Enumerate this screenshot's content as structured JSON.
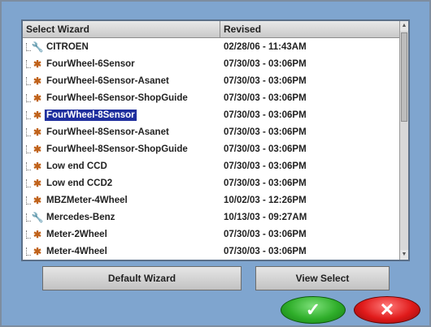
{
  "table": {
    "headers": {
      "name": "Select Wizard",
      "revised": "Revised"
    },
    "rows": [
      {
        "name": "CITROEN",
        "revised": "02/28/06 - 11:43AM",
        "icon": "wrench-icon"
      },
      {
        "name": "FourWheel-6Sensor",
        "revised": "07/30/03 - 03:06PM",
        "icon": "vehicle-icon"
      },
      {
        "name": "FourWheel-6Sensor-Asanet",
        "revised": "07/30/03 - 03:06PM",
        "icon": "vehicle-icon"
      },
      {
        "name": "FourWheel-6Sensor-ShopGuide",
        "revised": "07/30/03 - 03:06PM",
        "icon": "vehicle-icon"
      },
      {
        "name": "FourWheel-8Sensor",
        "revised": "07/30/03 - 03:06PM",
        "icon": "vehicle-icon",
        "selected": true
      },
      {
        "name": "FourWheel-8Sensor-Asanet",
        "revised": "07/30/03 - 03:06PM",
        "icon": "vehicle-icon"
      },
      {
        "name": "FourWheel-8Sensor-ShopGuide",
        "revised": "07/30/03 - 03:06PM",
        "icon": "vehicle-icon"
      },
      {
        "name": "Low end CCD",
        "revised": "07/30/03 - 03:06PM",
        "icon": "vehicle-icon"
      },
      {
        "name": "Low end CCD2",
        "revised": "07/30/03 - 03:06PM",
        "icon": "vehicle-icon"
      },
      {
        "name": "MBZMeter-4Wheel",
        "revised": "10/02/03 - 12:26PM",
        "icon": "vehicle-icon"
      },
      {
        "name": "Mercedes-Benz",
        "revised": "10/13/03 - 09:27AM",
        "icon": "wrench-icon"
      },
      {
        "name": "Meter-2Wheel",
        "revised": "07/30/03 - 03:06PM",
        "icon": "vehicle-icon"
      },
      {
        "name": "Meter-4Wheel",
        "revised": "07/30/03 - 03:06PM",
        "icon": "vehicle-icon"
      }
    ]
  },
  "buttons": {
    "default_wizard": "Default Wizard",
    "view_select": "View Select",
    "ok_icon": "checkmark-icon",
    "cancel_icon": "x-icon"
  },
  "colors": {
    "background": "#7fa5cf",
    "selection": "#1f2f9e",
    "ok": "#2fae2a",
    "cancel": "#e01a1a"
  }
}
